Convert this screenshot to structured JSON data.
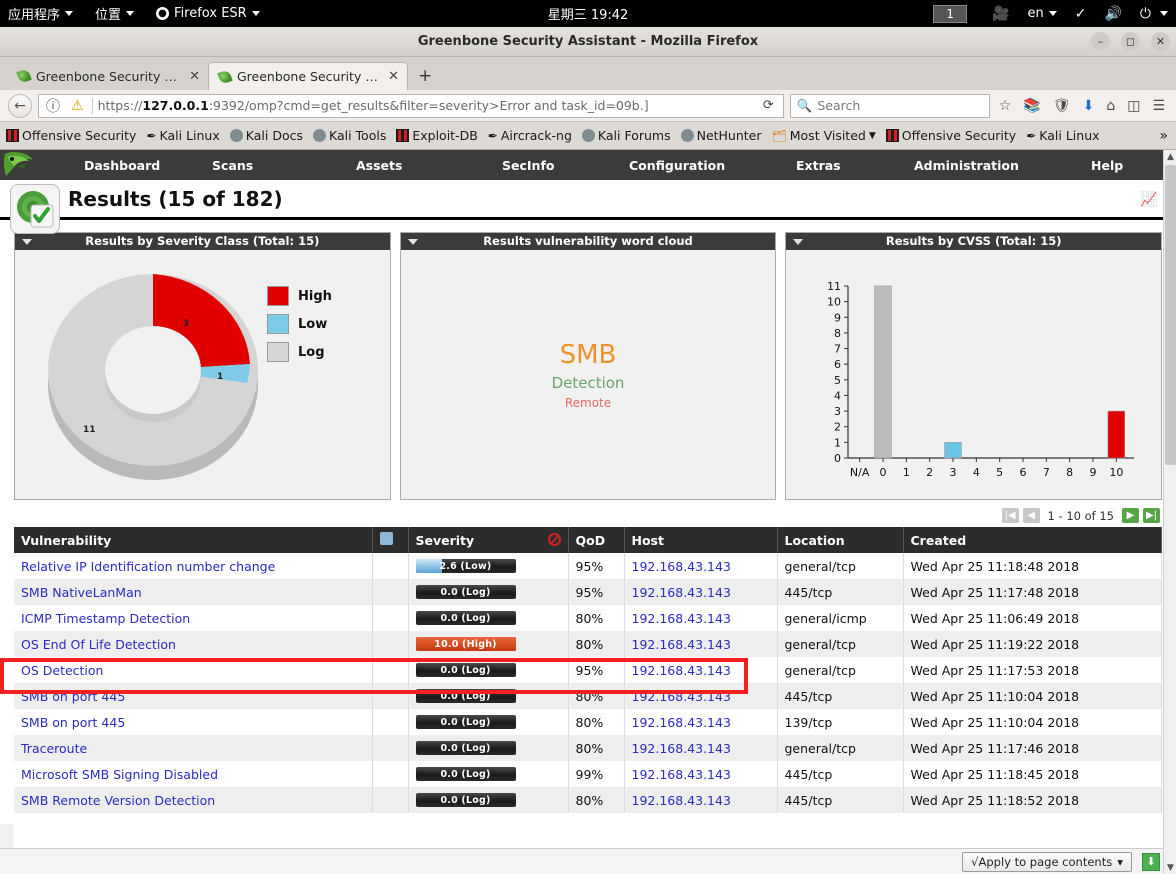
{
  "os_panel": {
    "applications": "应用程序",
    "places": "位置",
    "firefox": "Firefox ESR",
    "clock": "星期三 19:42",
    "workspace": "1",
    "language": "en",
    "icons": [
      "camera-icon",
      "pen-icon",
      "volume-muted-icon",
      "power-icon"
    ]
  },
  "browser": {
    "window_title": "Greenbone Security Assistant - Mozilla Firefox",
    "tabs": [
      {
        "label": "Greenbone Security A...",
        "active": false
      },
      {
        "label": "Greenbone Security A...",
        "active": true
      }
    ],
    "new_tab_label": "+",
    "url_prefix": "https://",
    "url_host": "127.0.0.1",
    "url_rest": ":9392/omp?cmd=get_results&filter=severity>Error and task_id=09b.]",
    "search_placeholder": "Search",
    "bookmarks": [
      {
        "label": "Offensive Security",
        "icon": "offsec-icon"
      },
      {
        "label": "Kali Linux",
        "icon": "dragon-icon"
      },
      {
        "label": "Kali Docs",
        "icon": "globe-icon"
      },
      {
        "label": "Kali Tools",
        "icon": "globe-icon"
      },
      {
        "label": "Exploit-DB",
        "icon": "exploitdb-icon"
      },
      {
        "label": "Aircrack-ng",
        "icon": "dragon-icon"
      },
      {
        "label": "Kali Forums",
        "icon": "globe-icon"
      },
      {
        "label": "NetHunter",
        "icon": "globe-icon"
      },
      {
        "label": "Most Visited",
        "icon": "folder-icon",
        "chevron": true
      },
      {
        "label": "Offensive Security",
        "icon": "offsec-icon"
      },
      {
        "label": "Kali Linux",
        "icon": "dragon-icon"
      }
    ],
    "bookmarks_overflow": "»"
  },
  "gsa": {
    "menu": [
      "Dashboard",
      "Scans",
      "Assets",
      "SecInfo",
      "Configuration",
      "Extras",
      "Administration",
      "Help"
    ],
    "page_title": "Results (15 of 182)",
    "page_title_icon": "chart-icon"
  },
  "chart_data": [
    {
      "type": "pie",
      "title": "Results by Severity Class (Total: 15)",
      "categories": [
        "High",
        "Low",
        "Log"
      ],
      "values": [
        3,
        1,
        11
      ],
      "colors": [
        "#e00000",
        "#7ecbe8",
        "#d5d5d5"
      ],
      "legend_position": "right",
      "donut": true
    },
    {
      "type": "wordcloud",
      "title": "Results vulnerability word cloud",
      "words": [
        {
          "text": "SMB",
          "size": 26,
          "color": "#f0922b"
        },
        {
          "text": "Detection",
          "size": 15,
          "color": "#6aa46a"
        },
        {
          "text": "Remote",
          "size": 12,
          "color": "#e06a62"
        }
      ]
    },
    {
      "type": "bar",
      "title": "Results by CVSS (Total: 15)",
      "categories": [
        "N/A",
        "0",
        "1",
        "2",
        "3",
        "4",
        "5",
        "6",
        "7",
        "8",
        "9",
        "10"
      ],
      "values": [
        0,
        11,
        0,
        0,
        1,
        0,
        0,
        0,
        0,
        0,
        0,
        3
      ],
      "bar_colors": [
        "#bbbbbb",
        "#bbbbbb",
        "#bbbbbb",
        "#bbbbbb",
        "#68c5e8",
        "#bbbbbb",
        "#bbbbbb",
        "#bbbbbb",
        "#bbbbbb",
        "#bbbbbb",
        "#bbbbbb",
        "#e00000"
      ],
      "yticks": [
        0,
        1,
        2,
        3,
        4,
        5,
        6,
        7,
        8,
        9,
        10,
        11
      ],
      "ylim": [
        0,
        11
      ],
      "xlabel": "",
      "ylabel": "",
      "grid": false
    }
  ],
  "pager": {
    "first_label": "|◀",
    "prev_label": "◀",
    "range_text": "1 - 10 of 15",
    "next_label": "▶",
    "last_label": "▶|"
  },
  "table": {
    "headers": [
      "Vulnerability",
      "",
      "Severity",
      "QoD",
      "Host",
      "Location",
      "Created"
    ],
    "header_icons": {
      "solution": "puzzle-icon",
      "severity": "no-entry-icon"
    },
    "rows": [
      {
        "vuln": "Relative IP Identification number change",
        "severity": "2.6 (Low)",
        "sev_value": 2.6,
        "sev_class": "low",
        "qod": "95%",
        "host": "192.168.43.143",
        "location": "general/tcp",
        "created": "Wed Apr 25 11:18:48 2018"
      },
      {
        "vuln": "SMB NativeLanMan",
        "severity": "0.0 (Log)",
        "sev_value": 0.0,
        "sev_class": "log",
        "qod": "95%",
        "host": "192.168.43.143",
        "location": "445/tcp",
        "created": "Wed Apr 25 11:17:48 2018"
      },
      {
        "vuln": "ICMP Timestamp Detection",
        "severity": "0.0 (Log)",
        "sev_value": 0.0,
        "sev_class": "log",
        "qod": "80%",
        "host": "192.168.43.143",
        "location": "general/icmp",
        "created": "Wed Apr 25 11:06:49 2018"
      },
      {
        "vuln": "OS End Of Life Detection",
        "severity": "10.0 (High)",
        "sev_value": 10.0,
        "sev_class": "high",
        "qod": "80%",
        "host": "192.168.43.143",
        "location": "general/tcp",
        "created": "Wed Apr 25 11:19:22 2018"
      },
      {
        "vuln": "OS Detection",
        "severity": "0.0 (Log)",
        "sev_value": 0.0,
        "sev_class": "log",
        "qod": "95%",
        "host": "192.168.43.143",
        "location": "general/tcp",
        "created": "Wed Apr 25 11:17:53 2018"
      },
      {
        "vuln": "SMB on port 445",
        "severity": "0.0 (Log)",
        "sev_value": 0.0,
        "sev_class": "log",
        "qod": "80%",
        "host": "192.168.43.143",
        "location": "445/tcp",
        "created": "Wed Apr 25 11:10:04 2018"
      },
      {
        "vuln": "SMB on port 445",
        "severity": "0.0 (Log)",
        "sev_value": 0.0,
        "sev_class": "log",
        "qod": "80%",
        "host": "192.168.43.143",
        "location": "139/tcp",
        "created": "Wed Apr 25 11:10:04 2018"
      },
      {
        "vuln": "Traceroute",
        "severity": "0.0 (Log)",
        "sev_value": 0.0,
        "sev_class": "log",
        "qod": "80%",
        "host": "192.168.43.143",
        "location": "general/tcp",
        "created": "Wed Apr 25 11:17:46 2018"
      },
      {
        "vuln": "Microsoft SMB Signing Disabled",
        "severity": "0.0 (Log)",
        "sev_value": 0.0,
        "sev_class": "log",
        "qod": "99%",
        "host": "192.168.43.143",
        "location": "445/tcp",
        "created": "Wed Apr 25 11:18:45 2018"
      },
      {
        "vuln": "SMB Remote Version Detection",
        "severity": "0.0 (Log)",
        "sev_value": 0.0,
        "sev_class": "log",
        "qod": "80%",
        "host": "192.168.43.143",
        "location": "445/tcp",
        "created": "Wed Apr 25 11:18:52 2018"
      }
    ],
    "highlighted_row_index": 3
  },
  "footer": {
    "apply_label": "√Apply to page contents",
    "apply_caret": "▾",
    "download_icon": "download-icon"
  },
  "colors": {
    "high": "#e00000",
    "low": "#7ecbe8",
    "log": "#d5d5d5",
    "annotation": "#f41f1f",
    "link": "#2b2bc0"
  }
}
